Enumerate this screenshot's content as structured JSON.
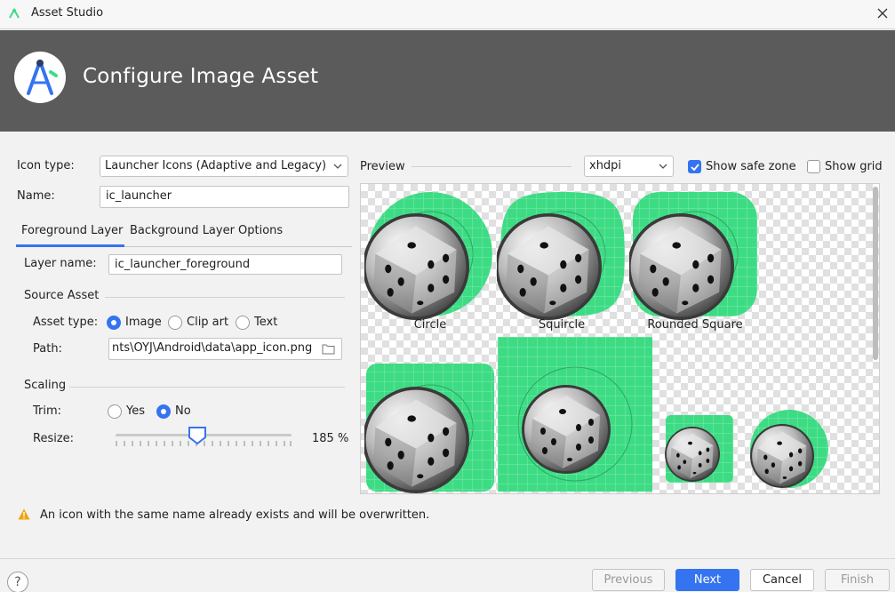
{
  "window": {
    "title": "Asset Studio"
  },
  "header": {
    "title": "Configure Image Asset"
  },
  "form": {
    "icon_type_label": "Icon type:",
    "icon_type_value": "Launcher Icons (Adaptive and Legacy)",
    "name_label": "Name:",
    "name_value": "ic_launcher"
  },
  "tabs": [
    {
      "label": "Foreground Layer",
      "active": true
    },
    {
      "label": "Background Layer",
      "active": false
    },
    {
      "label": "Options",
      "active": false
    }
  ],
  "foreground": {
    "layer_name_label": "Layer name:",
    "layer_name_value": "ic_launcher_foreground",
    "source_asset_title": "Source Asset",
    "asset_type_label": "Asset type:",
    "asset_type_options": [
      "Image",
      "Clip art",
      "Text"
    ],
    "asset_type_selected": "Image",
    "path_label": "Path:",
    "path_value": "nts\\OYJ\\Android\\data\\app_icon.png",
    "scaling_title": "Scaling",
    "trim_label": "Trim:",
    "trim_options": [
      "Yes",
      "No"
    ],
    "trim_selected": "No",
    "resize_label": "Resize:",
    "resize_value": "185 %",
    "resize_percent": 185
  },
  "preview": {
    "label": "Preview",
    "density_value": "xhdpi",
    "show_safe_zone_label": "Show safe zone",
    "show_safe_zone_checked": true,
    "show_grid_label": "Show grid",
    "show_grid_checked": false,
    "captions": [
      "Circle",
      "Squircle",
      "Rounded Square"
    ],
    "accent_color": "#3ddc84"
  },
  "warning": {
    "text": "An icon with the same name already exists and will be overwritten."
  },
  "footer": {
    "help_label": "?",
    "previous_label": "Previous",
    "next_label": "Next",
    "cancel_label": "Cancel",
    "finish_label": "Finish"
  }
}
